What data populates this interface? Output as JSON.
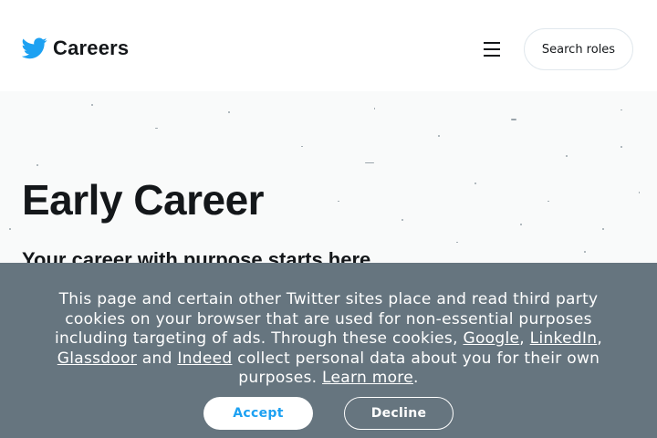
{
  "header": {
    "logo_icon": "twitter-bird-icon",
    "brand_color": "#1da1f2",
    "title": "Careers",
    "menu_icon": "hamburger-menu-icon",
    "search_label": "Search roles"
  },
  "hero": {
    "title": "Early Career",
    "subtitle": "Your career with purpose starts here"
  },
  "cookie_banner": {
    "background_color": "#66757f",
    "text_before": "This page and certain other Twitter sites place and read third party cookies on your browser that are used for non-essential purposes including targeting of ads. Through these cookies, ",
    "links": {
      "google": "Google",
      "linkedin": "LinkedIn",
      "glassdoor": "Glassdoor",
      "indeed": "Indeed",
      "learn_more": "Learn more"
    },
    "sep_comma_1": ",",
    "sep_comma_2": ",",
    "sep_and": " and ",
    "text_after": " collect personal data about you for their own purposes. ",
    "period": ".",
    "accept_label": "Accept",
    "decline_label": "Decline"
  }
}
